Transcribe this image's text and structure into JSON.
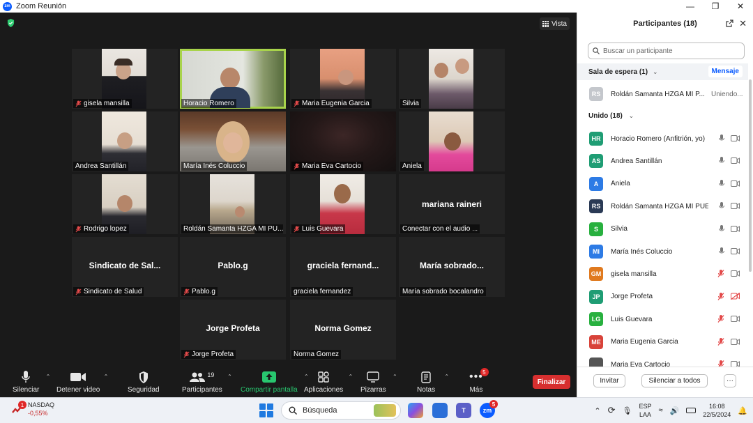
{
  "window": {
    "title": "Zoom Reunión",
    "logo": "zm"
  },
  "meeting": {
    "view_label": "Vista",
    "tiles": [
      {
        "id": "gisela",
        "name": "gisela mansilla",
        "muted": true,
        "has_video": true
      },
      {
        "id": "horacio",
        "name": "Horacio Romero",
        "muted": false,
        "has_video": true,
        "active": true
      },
      {
        "id": "maria-eugenia",
        "name": "Maria Eugenia Garcia",
        "muted": true,
        "has_video": true
      },
      {
        "id": "silvia",
        "name": "Silvia",
        "muted": false,
        "has_video": true
      },
      {
        "id": "andrea",
        "name": "Andrea Santillán",
        "muted": false,
        "has_video": true
      },
      {
        "id": "maria-ines",
        "name": "María Inés Coluccio",
        "muted": false,
        "has_video": true
      },
      {
        "id": "maria-eva",
        "name": "Maria Eva Cartocio",
        "muted": true,
        "has_video": true
      },
      {
        "id": "aniela",
        "name": "Aniela",
        "muted": false,
        "has_video": true
      },
      {
        "id": "rodrigo",
        "name": "Rodrigo lopez",
        "muted": true,
        "has_video": true
      },
      {
        "id": "roldan",
        "name": "Roldán Samanta HZGA MI PU...",
        "muted": false,
        "has_video": true
      },
      {
        "id": "luis",
        "name": "Luis Guevara",
        "muted": true,
        "has_video": true
      },
      {
        "id": "mariana",
        "name": "Conectar con el audio",
        "center_name": "mariana raineri",
        "muted": false,
        "has_video": false
      },
      {
        "id": "sindicato",
        "name": "Sindicato de Salud",
        "center_name": "Sindicato de Sal...",
        "muted": true,
        "has_video": false
      },
      {
        "id": "pablo",
        "name": "Pablo.g",
        "center_name": "Pablo.g",
        "muted": true,
        "has_video": false
      },
      {
        "id": "graciela",
        "name": "graciela fernandez",
        "center_name": "graciela fernand...",
        "muted": false,
        "has_video": false
      },
      {
        "id": "maria-sobrado",
        "name": "María sobrado bocalandro",
        "center_name": "María sobrado...",
        "muted": false,
        "has_video": false
      },
      {
        "id": "jorge",
        "name": "Jorge Profeta",
        "center_name": "Jorge Profeta",
        "muted": true,
        "has_video": false
      },
      {
        "id": "norma",
        "name": "Norma Gomez",
        "center_name": "Norma Gomez",
        "muted": false,
        "has_video": false
      }
    ]
  },
  "controls": {
    "mute": "Silenciar",
    "video": "Detener video",
    "security": "Seguridad",
    "participants": "Participantes",
    "participants_count": "19",
    "share": "Compartir pantalla",
    "apps": "Aplicaciones",
    "whiteboards": "Pizarras",
    "notes": "Notas",
    "more": "Más",
    "more_badge": "5",
    "end": "Finalizar"
  },
  "panel": {
    "title": "Participantes (18)",
    "search_placeholder": "Buscar un participante",
    "waiting_label": "Sala de espera (1)",
    "message_button": "Mensaje",
    "waiting": [
      {
        "initials": "RS",
        "name": "Roldán Samanta HZGA MI P...",
        "status": "Uniendo...",
        "color": "#c4c7cc"
      }
    ],
    "joined_label": "Unido (18)",
    "joined": [
      {
        "initials": "HR",
        "name": "Horacio Romero (Anfitrión, yo)",
        "color": "#1f9d74",
        "mic": "on",
        "cam": "on"
      },
      {
        "initials": "AS",
        "name": "Andrea Santillán",
        "color": "#1f9d74",
        "mic": "on",
        "cam": "on"
      },
      {
        "initials": "A",
        "name": "Aniela",
        "color": "#2d7be5",
        "mic": "on",
        "cam": "on"
      },
      {
        "initials": "RS",
        "name": "Roldán Samanta HZGA MI PUE...",
        "color": "#2a3a55",
        "mic": "on",
        "cam": "on"
      },
      {
        "initials": "S",
        "name": "Silvia",
        "color": "#28b03f",
        "mic": "on",
        "cam": "on"
      },
      {
        "initials": "MI",
        "name": "María Inés Coluccio",
        "color": "#2d7be5",
        "mic": "on",
        "cam": "on"
      },
      {
        "initials": "GM",
        "name": "gisela mansilla",
        "color": "#e07a1f",
        "mic": "muted",
        "cam": "on"
      },
      {
        "initials": "JP",
        "name": "Jorge Profeta",
        "color": "#1f9d74",
        "mic": "muted",
        "cam": "off"
      },
      {
        "initials": "LG",
        "name": "Luis Guevara",
        "color": "#28b03f",
        "mic": "muted",
        "cam": "on"
      },
      {
        "initials": "ME",
        "name": "Maria Eugenia Garcia",
        "color": "#d8433a",
        "mic": "muted",
        "cam": "on"
      },
      {
        "initials": "",
        "name": "Maria Eva Cartocio",
        "color": "#555555",
        "mic": "muted",
        "cam": "on"
      }
    ],
    "invite": "Invitar",
    "mute_all": "Silenciar a todos",
    "more": "···"
  },
  "taskbar": {
    "stock_name": "NASDAQ",
    "stock_change": "-0,55%",
    "stock_badge": "1",
    "search_label": "Búsqueda",
    "zoom_badge": "5",
    "lang_top": "ESP",
    "lang_bottom": "LAA",
    "time": "16:08",
    "date": "22/5/2024"
  },
  "colors": {
    "accent": "#0b5cff",
    "end": "#d72f2f",
    "active_speaker": "#a8d34b",
    "share": "#28c76f"
  }
}
